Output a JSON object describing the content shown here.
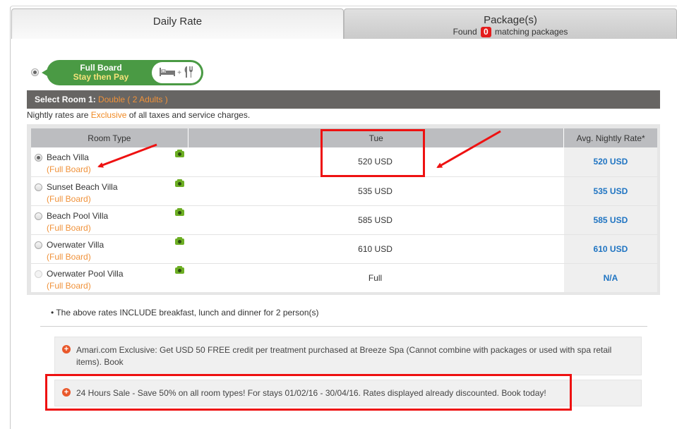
{
  "tabs": {
    "daily_rate": {
      "label": "Daily Rate",
      "active": true
    },
    "packages": {
      "label": "Package(s)",
      "found_prefix": "Found",
      "count": "0",
      "found_suffix": "matching packages"
    }
  },
  "board_option": {
    "line1": "Full Board",
    "line2": "Stay then Pay",
    "icons": [
      "bed-icon",
      "plus",
      "cutlery-icon"
    ],
    "plus": "+",
    "selected": true
  },
  "room_selection": {
    "label": "Select Room 1:",
    "value": "Double ( 2 Adults )"
  },
  "nightly_note": {
    "prefix": "Nightly rates are",
    "highlight": "Exclusive",
    "suffix": "of all taxes and service charges."
  },
  "table": {
    "headers": {
      "room_type": "Room Type",
      "day": "Tue",
      "avg": "Avg. Nightly Rate*"
    },
    "rows": [
      {
        "name": "Beach Villa",
        "board": "(Full Board)",
        "day_rate": "520 USD",
        "avg_rate": "520 USD",
        "selected": true,
        "disabled": false
      },
      {
        "name": "Sunset Beach Villa",
        "board": "(Full Board)",
        "day_rate": "535 USD",
        "avg_rate": "535 USD",
        "selected": false,
        "disabled": false
      },
      {
        "name": "Beach Pool Villa",
        "board": "(Full Board)",
        "day_rate": "585 USD",
        "avg_rate": "585 USD",
        "selected": false,
        "disabled": false
      },
      {
        "name": "Overwater Villa",
        "board": "(Full Board)",
        "day_rate": "610 USD",
        "avg_rate": "610 USD",
        "selected": false,
        "disabled": false
      },
      {
        "name": "Overwater Pool Villa",
        "board": "(Full Board)",
        "day_rate": "Full",
        "avg_rate": "N/A",
        "selected": false,
        "disabled": true
      }
    ]
  },
  "include_note": "• The above rates INCLUDE breakfast, lunch and dinner for 2 person(s)",
  "promotions": [
    {
      "text": "Amari.com Exclusive: Get USD 50 FREE credit per treatment purchased at Breeze Spa (Cannot combine with packages or used with spa retail items). Book"
    },
    {
      "text": "24 Hours Sale - Save 50% on all room types! For stays 01/02/16 - 30/04/16. Rates displayed already discounted. Book today!"
    }
  ],
  "colors": {
    "accent_orange": "#f0923a",
    "link_blue": "#1f74c2",
    "board_green": "#4a9a44",
    "annotation_red": "#ee1111",
    "badge_red": "#e41c1c"
  }
}
